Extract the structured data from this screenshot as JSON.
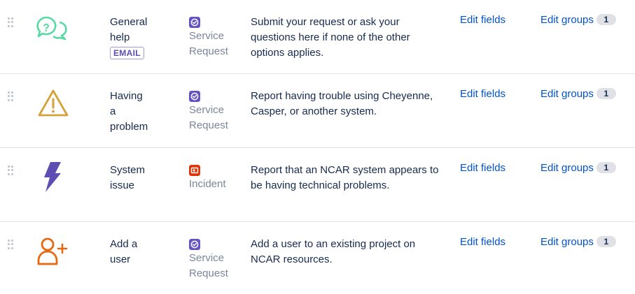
{
  "rows": [
    {
      "name_lines": [
        "General",
        "help"
      ],
      "badge": "EMAIL",
      "icon": "question-bubbles-icon",
      "category_lines": [
        "Service",
        "Request"
      ],
      "category_icon": "service-request-icon",
      "description": "Submit your request or ask your questions here if none of the other options applies.",
      "edit_fields": "Edit fields",
      "edit_groups": "Edit groups",
      "group_count": "1"
    },
    {
      "name_lines": [
        "Having",
        "a",
        "problem"
      ],
      "icon": "warning-triangle-icon",
      "category_lines": [
        "Service",
        "Request"
      ],
      "category_icon": "service-request-icon",
      "description": "Report having trouble using Cheyenne, Casper, or another system.",
      "edit_fields": "Edit fields",
      "edit_groups": "Edit groups",
      "group_count": "1"
    },
    {
      "name_lines": [
        "System",
        "issue"
      ],
      "icon": "lightning-bolt-icon",
      "category_lines": [
        "Incident"
      ],
      "category_icon": "incident-icon",
      "description": "Report that an NCAR system appears to be having technical problems.",
      "edit_fields": "Edit fields",
      "edit_groups": "Edit groups",
      "group_count": "1"
    },
    {
      "name_lines": [
        "Add a",
        "user"
      ],
      "icon": "add-user-icon",
      "category_lines": [
        "Service",
        "Request"
      ],
      "category_icon": "service-request-icon",
      "description": "Add a user to an existing project on NCAR resources.",
      "edit_fields": "Edit fields",
      "edit_groups": "Edit groups",
      "group_count": "1"
    }
  ],
  "colors": {
    "service_request": "#6554c0",
    "incident": "#de350b",
    "question_icon": "#57d9a3",
    "warning_icon": "#d5a13a",
    "bolt_icon": "#5e4db2",
    "user_icon": "#e56910",
    "link": "#0052cc"
  }
}
